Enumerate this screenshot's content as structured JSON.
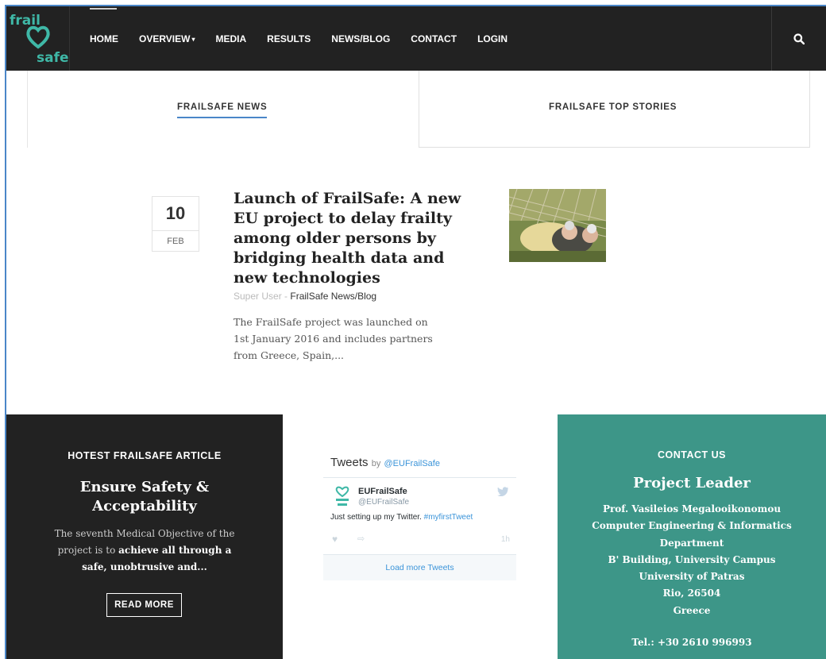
{
  "brand": {
    "logo_top": "frail",
    "logo_bottom": "safe"
  },
  "nav": {
    "items": [
      {
        "label": "HOME"
      },
      {
        "label": "OVERVIEW"
      },
      {
        "label": "MEDIA"
      },
      {
        "label": "RESULTS"
      },
      {
        "label": "NEWS/BLOG"
      },
      {
        "label": "CONTACT"
      },
      {
        "label": "LOGIN"
      }
    ],
    "search_icon": "search-icon"
  },
  "tabs": [
    {
      "label": "FRAILSAFE NEWS",
      "active": true
    },
    {
      "label": "FRAILSAFE TOP STORIES",
      "active": false
    }
  ],
  "article": {
    "day": "10",
    "month": "FEB",
    "title": "Launch of FrailSafe: A new EU project to delay frailty among older persons by bridging health data and new technologies",
    "author": "Super User",
    "separator": " - ",
    "category": "FrailSafe News/Blog",
    "intro": "The FrailSafe project was launched on 1st January 2016 and includes partners from Greece, Spain,..."
  },
  "hotest": {
    "heading": "HOTEST FRAILSAFE ARTICLE",
    "title": "Ensure Safety & Acceptability",
    "text_before": "The seventh Medical Objective of the project is to ",
    "text_bold": "achieve all through a safe, unobtrusive and...",
    "button": "READ MORE"
  },
  "twitter": {
    "heading": "Tweets",
    "by": "by",
    "handle": "@EUFrailSafe",
    "name": "EUFrailSafe",
    "user": "@EUFrailSafe",
    "text": "Just setting up my Twitter.",
    "hashtag": "#myfirstTweet",
    "time": "1h",
    "load_more": "Load more Tweets"
  },
  "contact": {
    "heading": "CONTACT US",
    "title": "Project Leader",
    "lines": [
      "Prof. Vasileios Megalooikonomou",
      "Computer Engineering & Informatics",
      "Department",
      "B' Building, University Campus",
      "University of Patras",
      "Rio, 26504",
      "Greece"
    ],
    "tel": "Tel.: +30 2610 996993"
  },
  "colors": {
    "nav_bg": "#222222",
    "teal": "#3d9688",
    "accent_blue": "#4a86c8",
    "logo_teal": "#3fb8a7"
  }
}
